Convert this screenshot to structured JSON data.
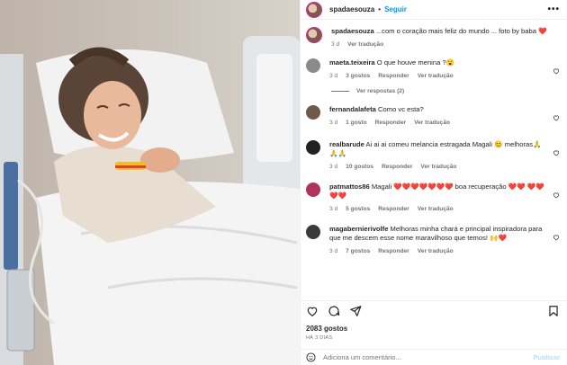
{
  "post": {
    "username": "spadaesouza",
    "follow_label": "Seguir",
    "more_label": "•••",
    "caption_user": "spadaesouza",
    "caption_text": "...com o coração mais feliz do mundo ... foto by baba ❤️",
    "caption_age": "3 d",
    "caption_translate": "Ver tradução",
    "likes": "2083 gostos",
    "time": "HÁ 3 DIAS",
    "add_comment_placeholder": "Adiciona um comentário...",
    "publish_label": "Publicar"
  },
  "comments": [
    {
      "user": "maeta.teixeira",
      "text": "O que houve menina ?😮",
      "age": "3 d",
      "likes": "3 gostos",
      "reply": "Responder",
      "translate": "Ver tradução",
      "replies": "Ver respostas (2)",
      "avatar_color": "#8a8a8a"
    },
    {
      "user": "fernandalafeta",
      "text": "Como vc esta?",
      "age": "3 d",
      "likes": "1 gosto",
      "reply": "Responder",
      "translate": "Ver tradução",
      "replies": "",
      "avatar_color": "#6e5a4a"
    },
    {
      "user": "realbarude",
      "text": "Ai ai ai comeu melancia estragada Magali 😊 melhoras🙏🙏🙏",
      "age": "3 d",
      "likes": "10 gostos",
      "reply": "Responder",
      "translate": "Ver tradução",
      "replies": "",
      "avatar_color": "#222222"
    },
    {
      "user": "patmattos86",
      "text": "Magali ❤️❤️❤️❤️❤️❤️❤️ boa recuperação ❤️❤️ ❤️❤️❤️❤️",
      "age": "3 d",
      "likes": "5 gostos",
      "reply": "Responder",
      "translate": "Ver tradução",
      "replies": "",
      "avatar_color": "#b0345a"
    },
    {
      "user": "magabernierivolfe",
      "text": "Melhoras minha chará e principal inspiradora para que me descem esse nome maravilhoso que temos! 🙌❤️",
      "age": "3 d",
      "likes": "7 gostos",
      "reply": "Responder",
      "translate": "Ver tradução",
      "replies": "",
      "avatar_color": "#3a3a3a"
    }
  ]
}
